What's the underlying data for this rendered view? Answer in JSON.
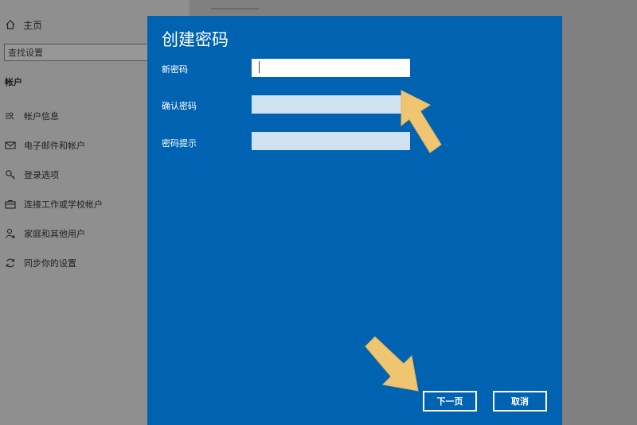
{
  "background": {
    "home_label": "主页",
    "search_placeholder": "查找设置",
    "section_title": "帐户",
    "nav_items": [
      {
        "label": "帐户信息",
        "icon": "account-info-icon"
      },
      {
        "label": "电子邮件和帐户",
        "icon": "mail-icon"
      },
      {
        "label": "登录选项",
        "icon": "key-icon"
      },
      {
        "label": "连接工作或学校帐户",
        "icon": "briefcase-icon"
      },
      {
        "label": "家庭和其他用户",
        "icon": "add-user-icon"
      },
      {
        "label": "同步你的设置",
        "icon": "sync-icon"
      }
    ]
  },
  "dialog": {
    "title": "创建密码",
    "fields": [
      {
        "label": "新密码",
        "value": ""
      },
      {
        "label": "确认密码",
        "value": ""
      },
      {
        "label": "密码提示",
        "value": ""
      }
    ],
    "next_label": "下一页",
    "cancel_label": "取消"
  },
  "colors": {
    "dialog_bg": "#0063b1",
    "arrow": "#f0c572",
    "input_inactive": "#cfe2f2"
  }
}
